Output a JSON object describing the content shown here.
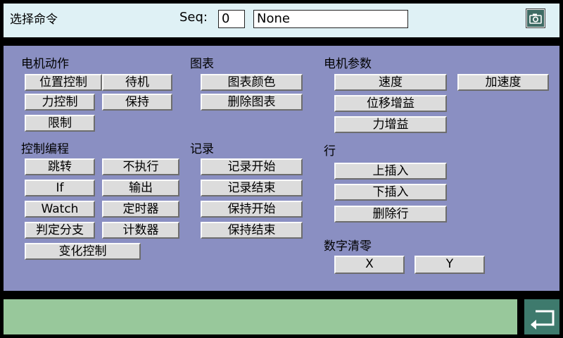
{
  "header": {
    "title": "选择命令",
    "seq_label": "Seq:",
    "seq_value": "0",
    "seq_name": "None"
  },
  "sections": {
    "motor_action": {
      "title": "电机动作",
      "buttons": {
        "position_control": "位置控制",
        "standby": "待机",
        "force_control": "力控制",
        "hold": "保持",
        "limit": "限制"
      }
    },
    "control_programming": {
      "title": "控制编程",
      "buttons": {
        "jump": "跳转",
        "no_execute": "不执行",
        "if": "If",
        "output": "输出",
        "watch": "Watch",
        "timer": "定时器",
        "branch": "判定分支",
        "counter": "计数器",
        "change_control": "变化控制"
      }
    },
    "chart": {
      "title": "图表",
      "buttons": {
        "chart_color": "图表颜色",
        "delete_chart": "删除图表"
      }
    },
    "record": {
      "title": "记录",
      "buttons": {
        "record_start": "记录开始",
        "record_end": "记录结束",
        "hold_start": "保持开始",
        "hold_end": "保持结束"
      }
    },
    "motor_params": {
      "title": "电机参数",
      "buttons": {
        "speed": "速度",
        "acceleration": "加速度",
        "displacement_gain": "位移增益",
        "force_gain": "力增益"
      }
    },
    "row": {
      "title": "行",
      "buttons": {
        "insert_above": "上插入",
        "insert_below": "下插入",
        "delete_row": "删除行"
      }
    },
    "digit_clear": {
      "title": "数字清零",
      "buttons": {
        "x": "X",
        "y": "Y"
      }
    }
  },
  "icons": {
    "camera": "camera-icon",
    "back": "return-arrow-icon"
  },
  "colors": {
    "panel": "#8a8fc2",
    "header": "#dff1f5",
    "status": "#98c89b",
    "back_button": "#3e7a6d"
  }
}
